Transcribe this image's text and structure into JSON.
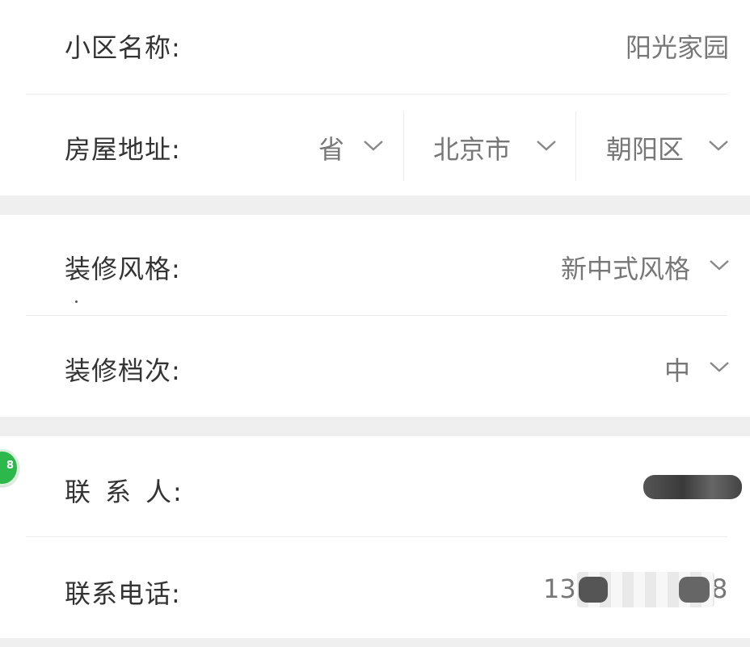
{
  "community": {
    "label": "小区名称:",
    "value": "阳光家园"
  },
  "address": {
    "label": "房屋地址:",
    "province": "省",
    "city": "北京市",
    "district": "朝阳区"
  },
  "decoration_style": {
    "label": "装修风格:",
    "value": "新中式风格"
  },
  "decoration_level": {
    "label": "装修档次:",
    "value": "中"
  },
  "contact_person": {
    "label_chars": [
      "联",
      "系",
      "人",
      ":"
    ],
    "value": ""
  },
  "contact_phone": {
    "label": "联系电话:",
    "value_prefix": "13",
    "value_suffix": "8"
  },
  "floating_badge": {
    "text": "8",
    "color": "#2db84c"
  },
  "colors": {
    "page_bg": "#efefef",
    "card_bg": "#ffffff",
    "label": "#333333",
    "value": "#777777"
  }
}
